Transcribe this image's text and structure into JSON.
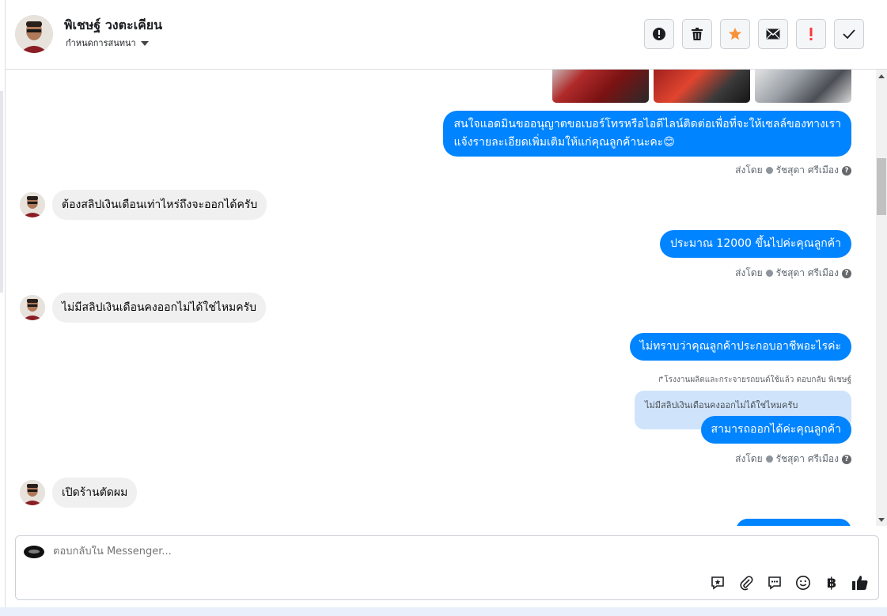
{
  "header": {
    "contact_name": "พิเชษฐ์ วงตะเคียน",
    "status_label": "กำหนดการสนทนา",
    "actions": [
      {
        "name": "spam-button",
        "icon": "alert-circle-icon"
      },
      {
        "name": "delete-button",
        "icon": "trash-icon"
      },
      {
        "name": "star-button",
        "icon": "star-icon",
        "color": "#f7923b"
      },
      {
        "name": "mark-unread-button",
        "icon": "envelope-icon"
      },
      {
        "name": "priority-button",
        "icon": "exclamation-icon",
        "color": "#fa383e"
      },
      {
        "name": "done-button",
        "icon": "check-icon"
      }
    ]
  },
  "thread": {
    "messages": [
      {
        "type": "outgoing",
        "text_line1": "สนใจแอดมินขออนุญาตขอเบอร์โทรหรือไอดีไลน์ติดต่อเพื่อที่จะให้เซลล์ของทางเรา",
        "text_line2": "แจ้งรายละเอียดเพิ่มเติมให้แก่คุณลูกค้านะคะ😊"
      },
      {
        "type": "meta",
        "sent_by": "ส่งโดย",
        "agent": "รัชสุดา ศรีเมือง"
      },
      {
        "type": "incoming",
        "text": "ต้องสลิปเงินเดือนเท่าไหร่ถึงจะออกได้ครับ"
      },
      {
        "type": "outgoing",
        "text": "ประมาณ 12000  ขึ้นไปค่ะคุณลูกค้า"
      },
      {
        "type": "meta",
        "sent_by": "ส่งโดย",
        "agent": "รัชสุดา ศรีเมือง"
      },
      {
        "type": "incoming",
        "text": "ไม่มีสลิปเงินเดือนคงออกไม่ได้ใช่ไหมครับ"
      },
      {
        "type": "outgoing",
        "text": "ไม่ทราบว่าคุณลูกค้าประกอบอาชีพอะไรค่ะ"
      },
      {
        "type": "reply_note",
        "text": "โรงงานผลิตและกระจายรถยนต์ใช้แล้ว ตอบกลับ พิเชษฐ์"
      },
      {
        "type": "quoted",
        "text": "ไม่มีสลิปเงินเดือนคงออกไม่ได้ใช่ไหมครับ"
      },
      {
        "type": "outgoing",
        "text": "สามารถออกได้ค่ะคุณลูกค้า"
      },
      {
        "type": "meta",
        "sent_by": "ส่งโดย",
        "agent": "รัชสุดา ศรีเมือง"
      },
      {
        "type": "incoming",
        "text": "เปิดร้านตัดผม"
      }
    ],
    "help_glyph": "?"
  },
  "composer": {
    "placeholder": "ตอบกลับใน Messenger...",
    "tools": [
      "saved-reply-icon",
      "attachment-icon",
      "chat-bubble-icon",
      "emoji-icon",
      "baht-icon",
      "thumbs-up-icon"
    ],
    "baht_glyph": "฿"
  },
  "colors": {
    "outgoing_bubble": "#0084ff",
    "incoming_bubble": "#f0f0f0",
    "quoted_bubble": "#cfe4fb"
  }
}
